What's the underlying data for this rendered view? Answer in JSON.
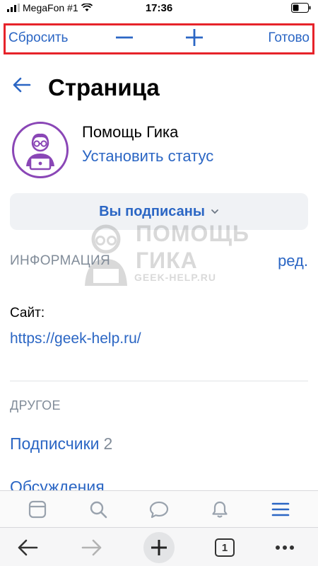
{
  "status_bar": {
    "carrier": "MegaFon #1",
    "time": "17:36",
    "icons": [
      "signal-icon",
      "wifi-icon",
      "battery-icon"
    ]
  },
  "zoom_toolbar": {
    "reset_label": "Сбросить",
    "done_label": "Готово",
    "highlight_color": "#e6232a"
  },
  "header": {
    "title": "Страница"
  },
  "profile": {
    "name": "Помощь Гика",
    "status_link": "Установить статус",
    "avatar_border_color": "#8a46b6"
  },
  "subscribe_button": {
    "label": "Вы подписаны"
  },
  "info_section": {
    "heading": "ИНФОРМАЦИЯ",
    "edit_label": "ред.",
    "site_label": "Сайт:",
    "site_url": "https://geek-help.ru/"
  },
  "watermark": {
    "line1": "ПОМОЩЬ",
    "line2": "ГИКА",
    "line3": "GEEK-HELP.RU"
  },
  "other_section": {
    "heading": "ДРУГОЕ",
    "subscribers_label": "Подписчики",
    "subscribers_count": "2",
    "discussions_label": "Обсуждения"
  },
  "tab_bar": {
    "items": [
      "feed-icon",
      "search-icon",
      "messages-icon",
      "notifications-icon",
      "menu-icon"
    ]
  },
  "browser_bar": {
    "tab_count": "1"
  },
  "colors": {
    "accent": "#2b66c4",
    "secondary_text": "#818c99",
    "button_bg": "#f0f2f5"
  }
}
